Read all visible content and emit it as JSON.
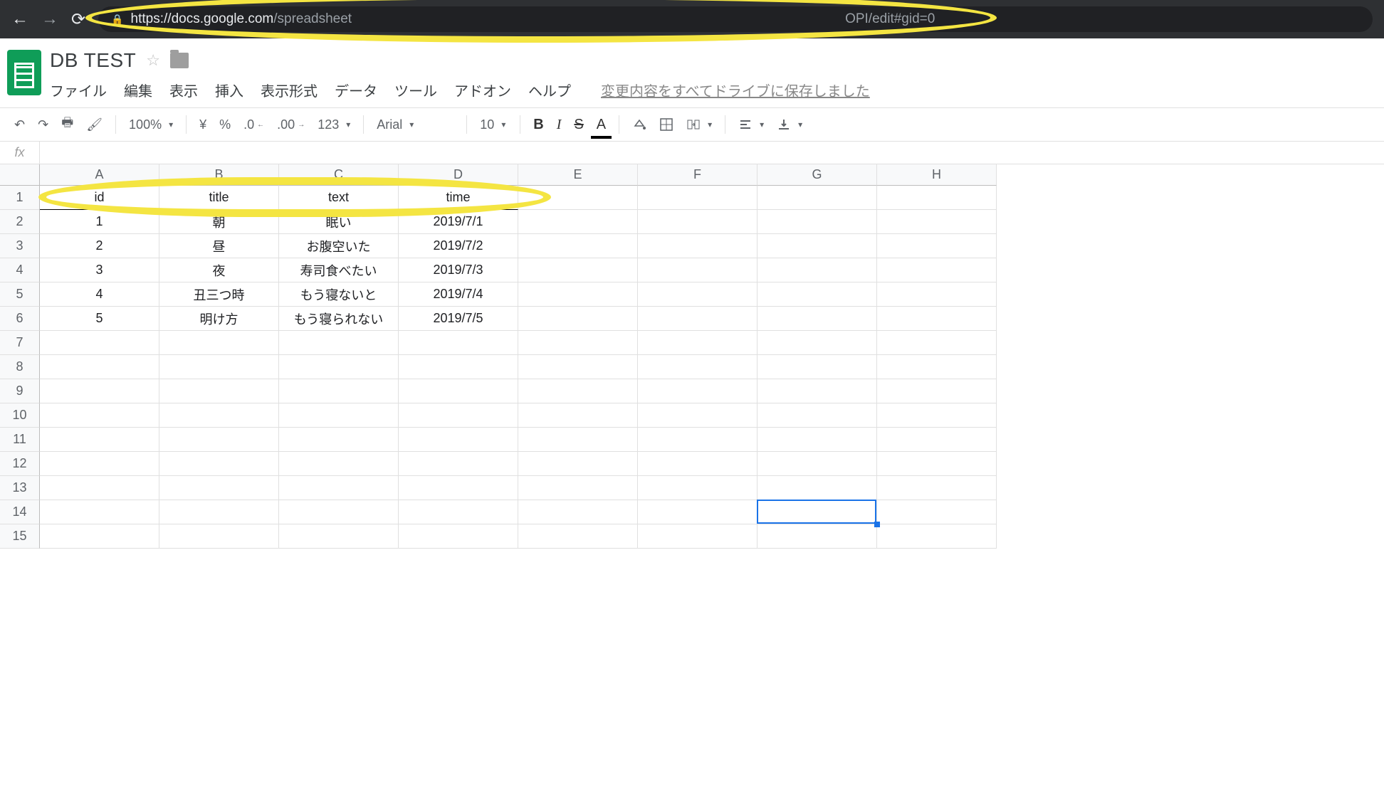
{
  "browser": {
    "url_host": "https://docs.google.com",
    "url_path_left": "/spreadsheet",
    "url_path_right": "OPI/edit#gid=0"
  },
  "doc": {
    "title": "DB TEST",
    "save_status": "変更内容をすべてドライブに保存しました"
  },
  "menus": {
    "file": "ファイル",
    "edit": "編集",
    "view": "表示",
    "insert": "挿入",
    "format": "表示形式",
    "data": "データ",
    "tools": "ツール",
    "addons": "アドオン",
    "help": "ヘルプ"
  },
  "toolbar": {
    "zoom": "100%",
    "currency": "¥",
    "percent": "%",
    "dec_less": ".0",
    "dec_more": ".00",
    "numfmt": "123",
    "font": "Arial",
    "fontsize": "10",
    "bold": "B",
    "italic": "I",
    "strike": "S",
    "textcolor": "A"
  },
  "columns": [
    "A",
    "B",
    "C",
    "D",
    "E",
    "F",
    "G",
    "H"
  ],
  "rows": [
    "1",
    "2",
    "3",
    "4",
    "5",
    "6",
    "7",
    "8",
    "9",
    "10",
    "11",
    "12",
    "13",
    "14",
    "15"
  ],
  "sheet_data": {
    "header": {
      "A": "id",
      "B": "title",
      "C": "text",
      "D": "time"
    },
    "r2": {
      "A": "1",
      "B": "朝",
      "C": "眠い",
      "D": "2019/7/1"
    },
    "r3": {
      "A": "2",
      "B": "昼",
      "C": "お腹空いた",
      "D": "2019/7/2"
    },
    "r4": {
      "A": "3",
      "B": "夜",
      "C": "寿司食べたい",
      "D": "2019/7/3"
    },
    "r5": {
      "A": "4",
      "B": "丑三つ時",
      "C": "もう寝ないと",
      "D": "2019/7/4"
    },
    "r6": {
      "A": "5",
      "B": "明け方",
      "C": "もう寝られない",
      "D": "2019/7/5"
    }
  },
  "fx": {
    "label": "fx",
    "value": ""
  },
  "selection": {
    "cell": "G14"
  }
}
